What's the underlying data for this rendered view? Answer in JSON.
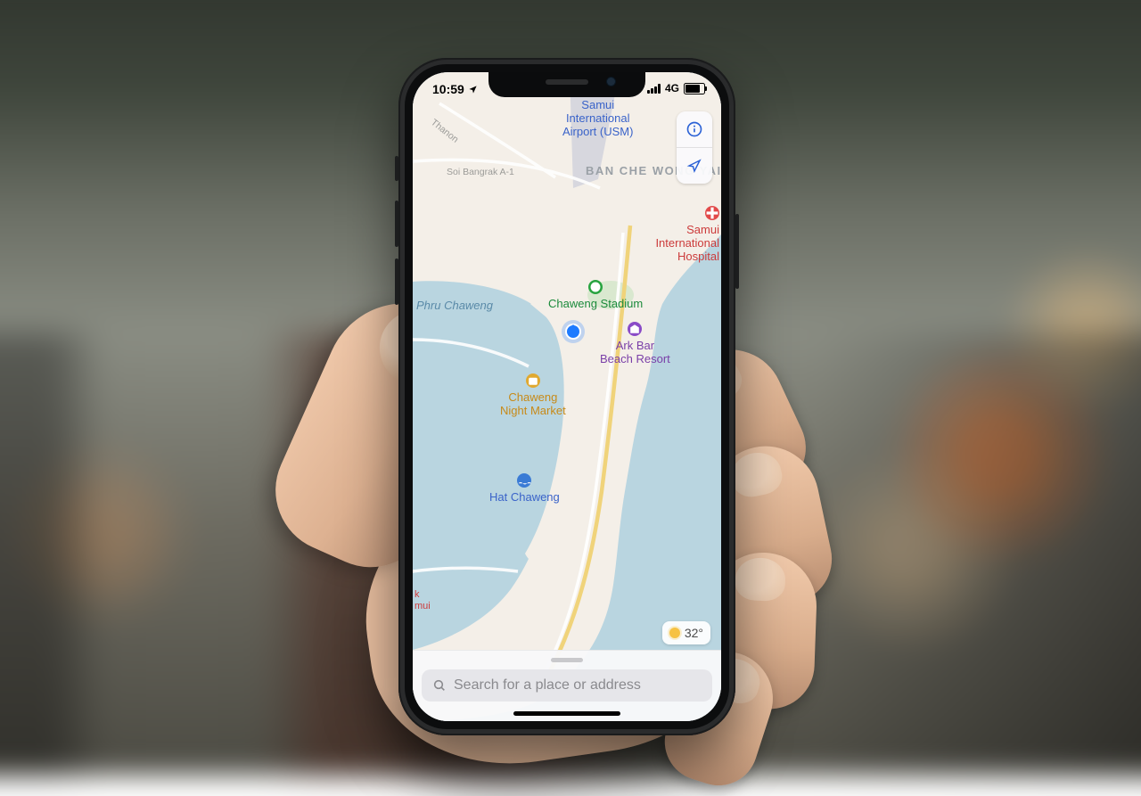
{
  "status_bar": {
    "time": "10:59",
    "location_arrow": true,
    "network": "4G",
    "signal_bars": 4,
    "battery_pct": 72
  },
  "map": {
    "region_water_label": "Phru Chaweng",
    "neighborhood": "BAN CHE WONG YAI",
    "roads": {
      "thanon": "Thanon",
      "soi_bangrak": "Soi Bangrak A-1"
    },
    "pois": {
      "airport": {
        "line1": "Samui",
        "line2": "International",
        "line3": "Airport (USM)"
      },
      "hospital": {
        "line1": "Samui",
        "line2": "International",
        "line3": "Hospital"
      },
      "stadium": "Chaweng Stadium",
      "ark_bar": {
        "line1": "Ark Bar",
        "line2": "Beach Resort"
      },
      "night_market": {
        "line1": "Chaweng",
        "line2": "Night Market"
      },
      "hat_chaweng": "Hat Chaweng",
      "partial_bottom": {
        "line1": "k",
        "line2": "mui"
      }
    }
  },
  "controls": {
    "info": "Info",
    "locate": "Locate"
  },
  "weather": {
    "temp": "32°",
    "icon": "sunny"
  },
  "search": {
    "placeholder": "Search for a place or address"
  }
}
